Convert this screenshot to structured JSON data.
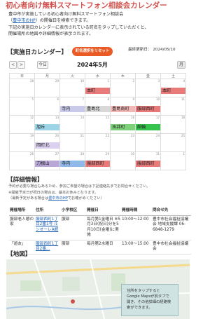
{
  "title": "初心者向け無料スマートフォン相談会カレンダー",
  "intro": {
    "line1": "豊中市が実施している初心者向け無料スマートフォン相談会",
    "link": "豊中市のHP",
    "line2_suffix": "の開催日を検索できます。",
    "line3": "下記の実施日カレンダーに表示されている町名をタップしていただくと、",
    "line4": "開催場所の地図や詳細情報が表示されます。"
  },
  "calendar_section": {
    "heading": "【実施日カレンダー】",
    "reset_button": "町名選択をリセット",
    "updated_label": "最終更新日：",
    "updated_date": "2024/05/10",
    "prev_label": "<",
    "next_label": ">",
    "today_label": "今日",
    "month_title": "2024年5月",
    "view_label": "月",
    "weekdays": [
      "日",
      "月",
      "火",
      "水",
      "木",
      "金",
      "土"
    ],
    "weeks": [
      [
        {
          "day": "28",
          "events": []
        },
        {
          "day": "29",
          "events": []
        },
        {
          "day": "30",
          "events": []
        },
        {
          "day": "1",
          "events": []
        },
        {
          "day": "2",
          "events": []
        },
        {
          "day": "3",
          "events": []
        },
        {
          "day": "4",
          "events": []
        }
      ],
      [
        {
          "day": "5",
          "events": []
        },
        {
          "day": "6",
          "events": []
        },
        {
          "day": "7",
          "events": [
            {
              "label": "寺内",
              "color": "#c9c9e9"
            }
          ]
        },
        {
          "day": "8",
          "events": [
            {
              "label": "豊島北",
              "color": "#d8d8d8"
            }
          ]
        },
        {
          "day": "9",
          "events": [
            {
              "label": "豊島南町",
              "color": "#f0b7b4"
            }
          ]
        },
        {
          "day": "10",
          "events": [
            {
              "label": "服部西町",
              "color": "#e87a7a"
            }
          ]
        },
        {
          "day": "11",
          "events": []
        }
      ],
      [
        {
          "day": "12",
          "events": []
        },
        {
          "day": "13",
          "events": [
            {
              "label": "旭丘",
              "color": "#9dd4e8"
            }
          ]
        },
        {
          "day": "14",
          "events": []
        },
        {
          "day": "15",
          "events": []
        },
        {
          "day": "16",
          "events": [
            {
              "label": "玉井町",
              "color": "#7fd07a"
            }
          ]
        },
        {
          "day": "17",
          "events": [
            {
              "label": "館輪",
              "color": "#36c44e"
            }
          ]
        },
        {
          "day": "18",
          "events": []
        }
      ],
      [
        {
          "day": "19",
          "events": []
        },
        {
          "day": "20",
          "events": [
            {
              "label": "岡町北",
              "color": "#dcd0f0"
            }
          ]
        },
        {
          "day": "21",
          "events": []
        },
        {
          "day": "22",
          "events": []
        },
        {
          "day": "23",
          "events": []
        },
        {
          "day": "24",
          "events": []
        },
        {
          "day": "25",
          "events": []
        }
      ],
      [
        {
          "day": "26",
          "events": []
        },
        {
          "day": "27",
          "events": [
            {
              "label": "刀根山",
              "color": "#b9a7d8"
            }
          ]
        },
        {
          "day": "28",
          "events": [
            {
              "label": "寺内",
              "color": "#8fb9e8"
            }
          ]
        },
        {
          "day": "29",
          "events": [
            {
              "label": "服部西町",
              "color": "#e87a7a"
            }
          ]
        },
        {
          "day": "30",
          "events": []
        },
        {
          "day": "31",
          "events": [
            {
              "label": "服部西町",
              "color": "#e87a7a"
            }
          ]
        },
        {
          "day": "1",
          "events": []
        }
      ]
    ],
    "top_row_events": [
      {
        "col": 2,
        "label": "本町",
        "color": "#e87a7a"
      },
      {
        "col": 5,
        "label": "本町",
        "color": "#e87a7a"
      }
    ]
  },
  "detail_section": {
    "heading": "【詳細情報】",
    "note1": "予約が必要な場合もあるため、参加ご希望の場合は下記連絡先までお問合せください。",
    "note2": "※開催予定日が祝日の場合は、基本お休みとなります。",
    "note3_prefix": "（最新予定がある場合は",
    "note3_link": "豊中市のHP",
    "note3_suffix": "でお確かめください）",
    "headers": [
      "開催場所",
      "住所",
      "小学校区",
      "開催日",
      "開催時間",
      "問合せ先"
    ],
    "rows": [
      {
        "place": "服部老人憩の家",
        "address": "服部西町1丁目2番1号 ルシオーレA館",
        "school": "服部",
        "date": "毎月第1金曜日 ※5月3日(祝日)分を5月10日(金曜)に実施",
        "time": "10:00～12:00",
        "contact": "豊中市社会福祉協議会 地域支援課 06-6848-1279"
      },
      {
        "place": "「遊友」",
        "address": "服部西町1丁目2番...",
        "school": "服部",
        "date": "毎月第2水曜日",
        "time": "13:00～15:00",
        "contact": "豊中市社会福祉協議会"
      }
    ]
  },
  "map_section": {
    "heading": "【地図】",
    "tooltip": "住所をタップすると Google Mapsが別タブで開き、その他詳細の経路検索ができます。"
  }
}
